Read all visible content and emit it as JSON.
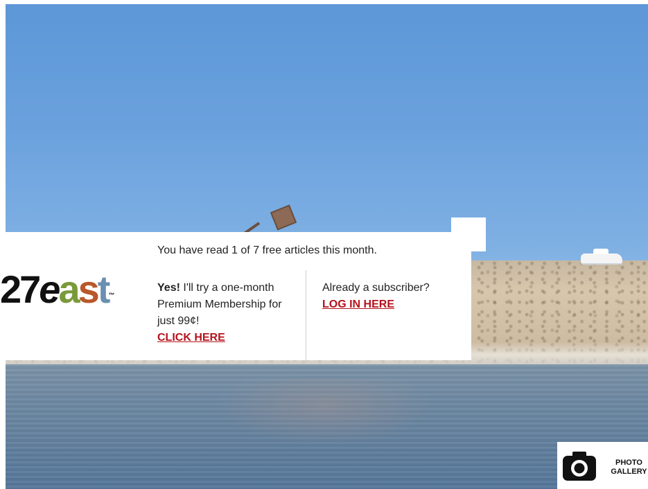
{
  "paywall": {
    "logo": {
      "num": "27",
      "e": "e",
      "a": "a",
      "s": "s",
      "t": "t",
      "tm": "™"
    },
    "read_count": "You have read 1 of 7 free articles this month.",
    "offer": {
      "yes": "Yes!",
      "text": " I'll try a one-month Premium Membership for just 99¢!",
      "cta": "CLICK HERE"
    },
    "subscriber": {
      "text": "Already a subscriber?",
      "cta": "LOG IN HERE"
    }
  },
  "gallery": {
    "line1": "PHOTO",
    "line2": "GALLERY",
    "icon": "camera-icon"
  },
  "colors": {
    "link": "#b5121b",
    "text": "#222222"
  }
}
